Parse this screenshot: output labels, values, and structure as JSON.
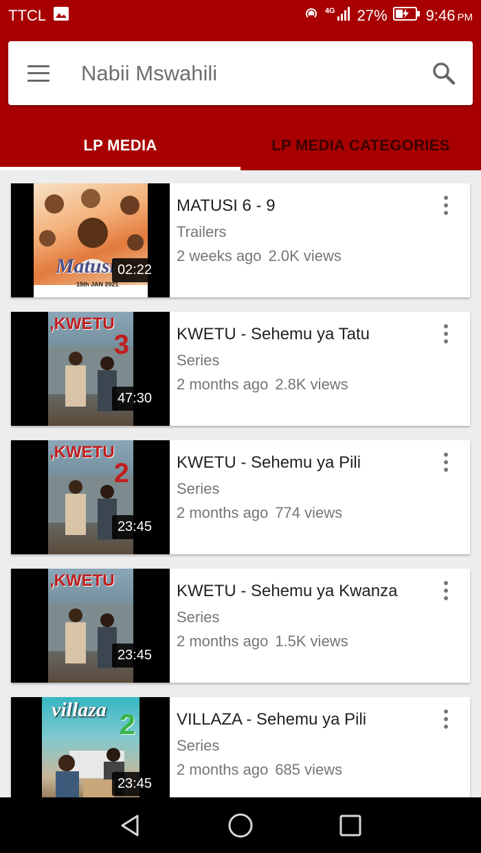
{
  "status_bar": {
    "carrier": "TTCL",
    "network": "4G",
    "battery": "27%",
    "time": "9:46",
    "ampm": "PM"
  },
  "header": {
    "title": "Nabii Mswahili",
    "tabs": [
      {
        "label": "LP MEDIA",
        "active": true
      },
      {
        "label": "LP MEDIA CATEGORIES",
        "active": false
      }
    ]
  },
  "videos": [
    {
      "title": "MATUSI 6 - 9",
      "category": "Trailers",
      "age": "2 weeks ago",
      "views": "2.0K views",
      "duration": "02:22",
      "poster": "Matusi",
      "poster_date": "15th JAN 2021"
    },
    {
      "title": "KWETU - Sehemu ya Tatu",
      "category": "Series",
      "age": "2 months ago",
      "views": "2.8K views",
      "duration": "47:30",
      "poster": ",KWETU",
      "poster_number": "3"
    },
    {
      "title": "KWETU - Sehemu ya Pili",
      "category": "Series",
      "age": "2 months ago",
      "views": "774 views",
      "duration": "23:45",
      "poster": ",KWETU",
      "poster_number": "2"
    },
    {
      "title": "KWETU - Sehemu ya Kwanza",
      "category": "Series",
      "age": "2 months ago",
      "views": "1.5K views",
      "duration": "23:45",
      "poster": ",KWETU"
    },
    {
      "title": "VILLAZA - Sehemu ya Pili",
      "category": "Series",
      "age": "2 months ago",
      "views": "685 views",
      "duration": "23:45",
      "poster": "villaza",
      "poster_number": "2"
    }
  ],
  "colors": {
    "brand": "#a80000",
    "tab_inactive": "#3a0000"
  }
}
